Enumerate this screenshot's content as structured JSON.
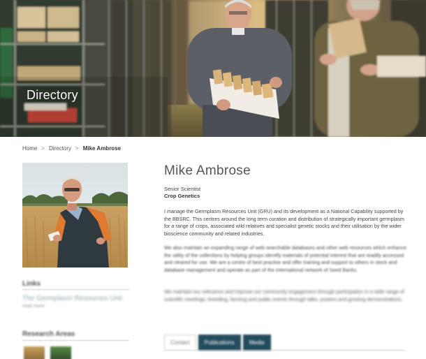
{
  "hero": {
    "title": "Directory"
  },
  "breadcrumb": {
    "home": "Home",
    "section": "Directory",
    "current": "Mike Ambrose",
    "separator": ">"
  },
  "profile": {
    "name": "Mike Ambrose",
    "job_title": "Senior Scientist",
    "department": "Crop Genetics",
    "paragraphs": [
      "I manage the Germplasm Resources Unit (GRU) and its development as a National Capability supported by the BBSRC. This centres around the long term curation and distribution of strategically important germplasm for a range of crops, associated wild relatives and specialist genetic stocks and their utilisation by the wider bioscience community and related industries.",
      "We also maintain an expanding range of web searchable databases and other web resources which enhance the utility of the collections by helping groups identify materials of potential interest that are readily accessed and cleared for use. We are a centre of best practise and offer training and support to others in stock and database management and operate as part of the International network of Seed Banks.",
      "We maintain our relevance and improve our community engagement through participation in a wide range of scientific meetings, breeding, farming and public events through talks, posters and growing demonstrations."
    ]
  },
  "sidebar": {
    "links_heading": "Links",
    "link_item": "The Germplasm Resources Unit",
    "read_more": "read more",
    "research_heading": "Research Areas"
  },
  "tabs": [
    {
      "label": "Contact"
    },
    {
      "label": "Publications"
    },
    {
      "label": "Media"
    }
  ],
  "colors": {
    "tab_dark": "#234c5c",
    "link": "#8fa7ac"
  }
}
